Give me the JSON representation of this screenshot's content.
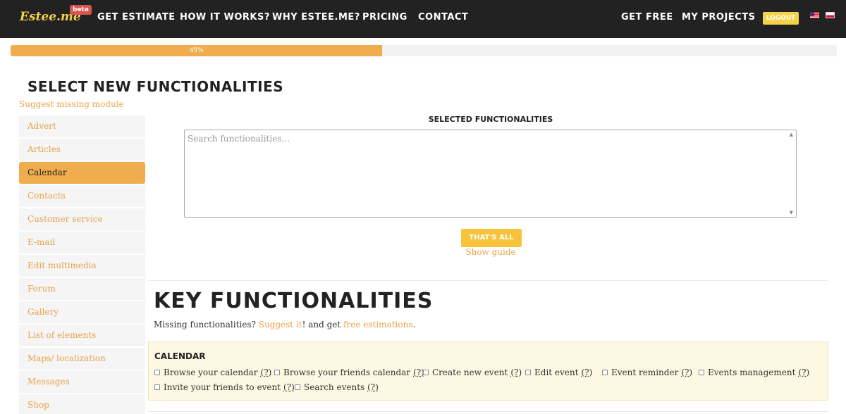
{
  "nav": {
    "logo": "Estee.me",
    "beta": "beta",
    "links": [
      "GET ESTIMATE",
      "HOW IT WORKS?",
      "WHY ESTEE.ME?",
      "PRICING",
      "CONTACT"
    ],
    "right_links": [
      "GET FREE",
      "MY PROJECTS"
    ],
    "logout": "LOGOUT",
    "flags": [
      "us-flag-icon",
      "pl-flag-icon"
    ]
  },
  "progress": {
    "label": "45%",
    "fraction": 0.45,
    "color": "#f0ad4e"
  },
  "page_title": "SELECT NEW FUNCTIONALITIES",
  "suggest_missing": "Suggest missing module",
  "sidebar": {
    "active": "Calendar",
    "items": [
      "Advert",
      "Articles",
      "Calendar",
      "Contacts",
      "Customer service",
      "E-mail",
      "Edit multimedia",
      "Forum",
      "Gallery",
      "List of elements",
      "Maps/ localization",
      "Messages",
      "Shop"
    ]
  },
  "selected": {
    "title": "SELECTED FUNCTIONALITIES",
    "placeholder": "Search functionalities...",
    "button": "THAT'S ALL",
    "guide": "Show guide"
  },
  "key": {
    "title": "KEY FUNCTIONALITIES",
    "missing_prefix": "Missing functionalities? ",
    "suggest_link": "Suggest it",
    "missing_middle": "! and get ",
    "free_link": "free estimations",
    "missing_suffix": "."
  },
  "calendar": {
    "title": "CALENDAR",
    "help": "(?)",
    "functions": [
      "Browse your calendar",
      "Browse your friends calendar",
      "Create new event",
      "Edit event",
      "Event reminder",
      "Events management",
      "Invite your friends to event",
      "Search events"
    ]
  },
  "colors": {
    "accent": "#f0ad4e",
    "link": "#e8a24a",
    "navbar": "#222222",
    "button": "#f6c33a",
    "calendar_bg": "#fcf8e3"
  }
}
